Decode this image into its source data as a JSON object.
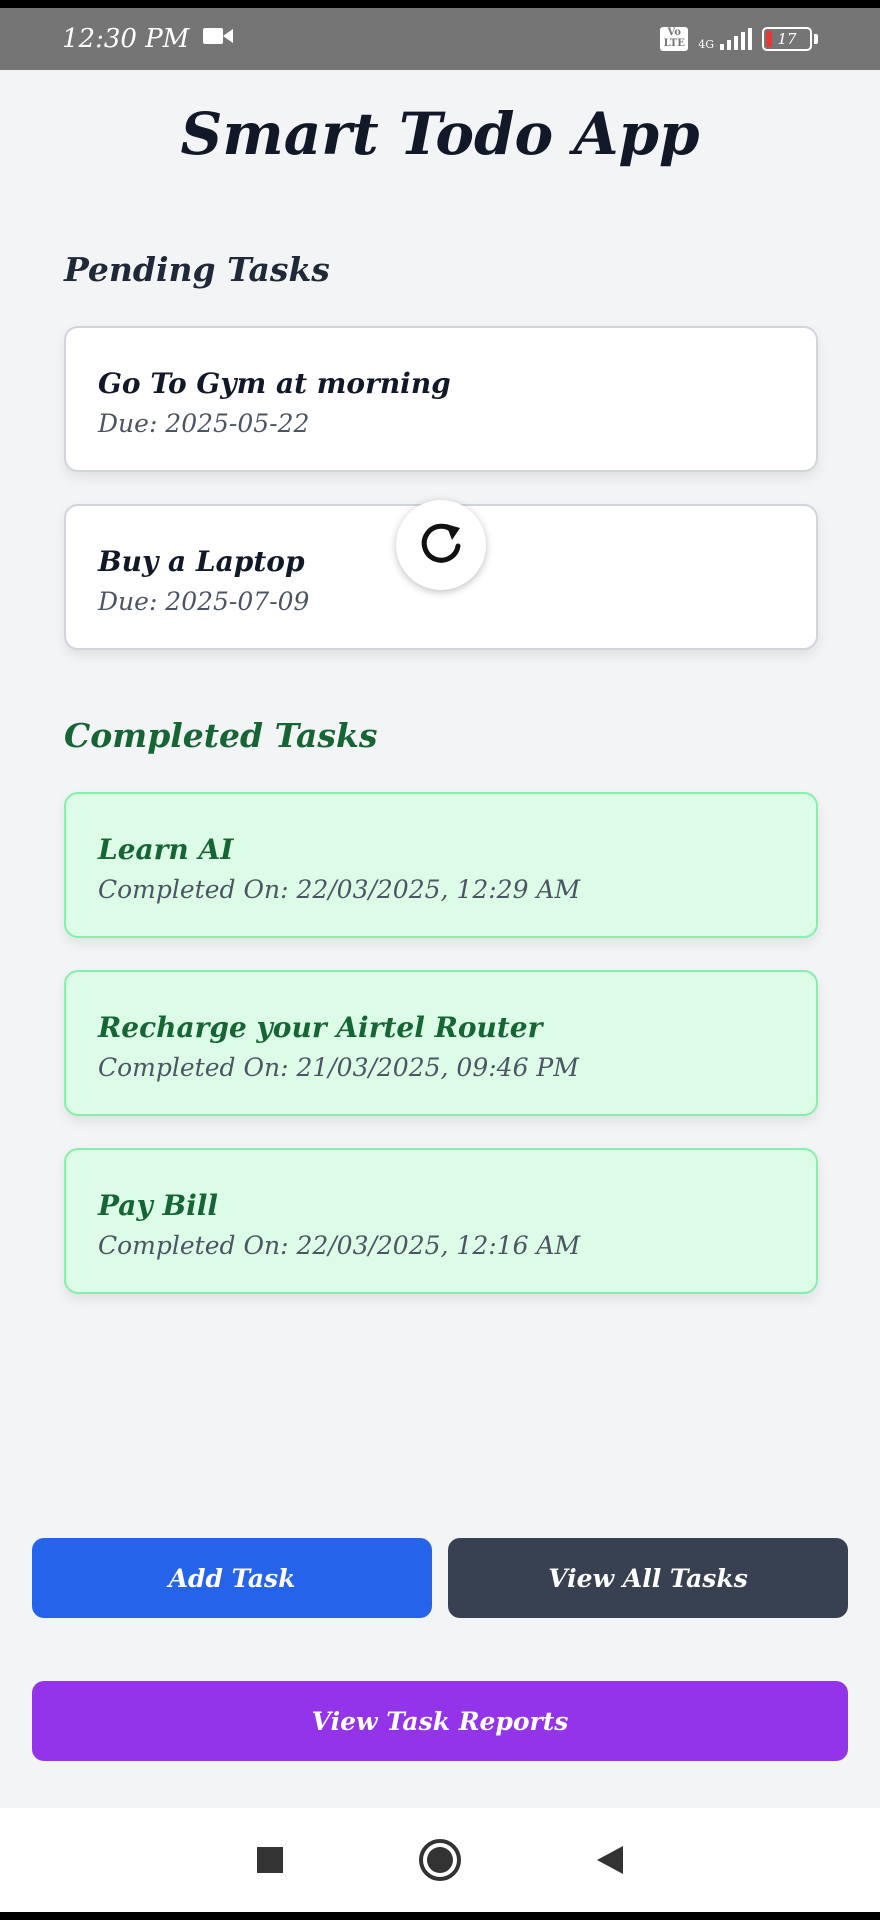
{
  "status_bar": {
    "time": "12:30 PM",
    "volte_label": "Vo LTE",
    "network": "4G",
    "battery": "17",
    "icons": [
      "video-camera-icon",
      "volte-icon",
      "signal-icon",
      "battery-icon"
    ]
  },
  "app": {
    "title": "Smart Todo App"
  },
  "pending": {
    "heading": "Pending Tasks",
    "tasks": [
      {
        "title": "Go To Gym at morning",
        "due": "Due: 2025-05-22"
      },
      {
        "title": "Buy a Laptop",
        "due": "Due: 2025-07-09"
      }
    ]
  },
  "completed": {
    "heading": "Completed Tasks",
    "tasks": [
      {
        "title": "Learn AI",
        "completed_on": "Completed On: 22/03/2025, 12:29 AM"
      },
      {
        "title": "Recharge your Airtel Router",
        "completed_on": "Completed On: 21/03/2025, 09:46 PM"
      },
      {
        "title": "Pay Bill",
        "completed_on": "Completed On: 22/03/2025, 12:16 AM"
      }
    ]
  },
  "refresh": {
    "icon": "refresh-icon"
  },
  "actions": {
    "add_task": "Add Task",
    "view_all": "View All Tasks",
    "view_reports": "View Task Reports"
  },
  "colors": {
    "add_task": "#2563eb",
    "view_all": "#374151",
    "view_reports": "#9333ea",
    "completed_bg": "#dcfce7",
    "completed_text": "#166534"
  },
  "nav_bar": {
    "icons": [
      "recents-square-icon",
      "home-circle-icon",
      "back-triangle-icon"
    ]
  }
}
